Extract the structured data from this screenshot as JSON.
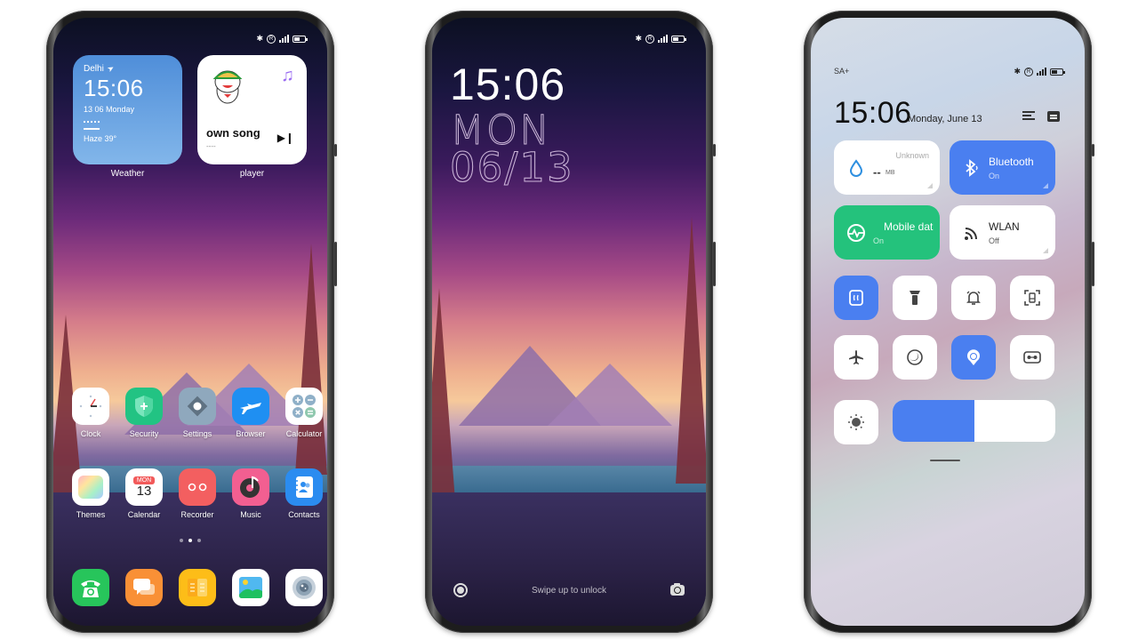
{
  "phones": {
    "home": {
      "status_icons": [
        "bluetooth-icon",
        "registered-icon",
        "signal-icon",
        "battery-icon"
      ],
      "weather_widget": {
        "city": "Delhi",
        "time": "15:06",
        "date": "13 06 Monday",
        "condition": "Haze 39°",
        "label": "Weather",
        "bg_color": "#5a9ae0"
      },
      "player_widget": {
        "song": "own song",
        "artist": "----",
        "label": "player",
        "note_glyph": "♫",
        "next_glyph": "▶❙"
      },
      "apps_row1": [
        {
          "label": "Clock",
          "icon": "clock-icon",
          "color": "#ffffff"
        },
        {
          "label": "Security",
          "icon": "shield-icon",
          "color": "#22c383"
        },
        {
          "label": "Settings",
          "icon": "settings-icon",
          "color": "#8fa8bd"
        },
        {
          "label": "Browser",
          "icon": "plane-icon",
          "color": "#1f8ff2"
        },
        {
          "label": "Calculator",
          "icon": "calculator-icon",
          "color": "#ffffff"
        }
      ],
      "apps_row2": [
        {
          "label": "Themes",
          "icon": "themes-icon",
          "color": "#ffffff"
        },
        {
          "label": "Calendar",
          "icon": "calendar-icon",
          "color": "#ffffff",
          "day": "MON",
          "date": "13"
        },
        {
          "label": "Recorder",
          "icon": "recorder-icon",
          "color": "#f35f60"
        },
        {
          "label": "Music",
          "icon": "music-icon",
          "color": "#f25f91"
        },
        {
          "label": "Contacts",
          "icon": "contacts-icon",
          "color": "#2b8cf0"
        }
      ],
      "page_dots": {
        "count": 3,
        "active": 2
      },
      "dock": [
        {
          "name": "phone",
          "icon": "phone-icon",
          "color": "#27c55b"
        },
        {
          "name": "messages",
          "icon": "messages-icon",
          "color": "#f99036"
        },
        {
          "name": "notes",
          "icon": "notes-icon",
          "color": "#fdbd18"
        },
        {
          "name": "gallery",
          "icon": "gallery-icon",
          "color": "#ffffff"
        },
        {
          "name": "camera",
          "icon": "camera-lens-icon",
          "color": "#ffffff"
        }
      ]
    },
    "lock": {
      "time": "15:06",
      "day": "MON",
      "date": "06/13",
      "swipe_hint": "Swipe up to unlock"
    },
    "control_center": {
      "carrier": "SA+",
      "time": "15:06",
      "date": "Monday, June 13",
      "big_tiles": [
        {
          "title": "Unknown",
          "value": "--",
          "unit": "MB",
          "icon": "water-drop-icon",
          "state": "data-usage"
        },
        {
          "title": "Bluetooth",
          "sub": "On",
          "icon": "bluetooth-icon",
          "state": "active"
        },
        {
          "title": "Mobile data",
          "sub": "On",
          "icon": "mobile-data-icon",
          "state": "active"
        },
        {
          "title": "WLAN",
          "sub": "Off",
          "icon": "wifi-icon",
          "state": "inactive"
        }
      ],
      "small_tiles": [
        {
          "name": "vibrate",
          "icon": "vibrate-icon",
          "active": true
        },
        {
          "name": "flashlight",
          "icon": "flashlight-icon",
          "active": false
        },
        {
          "name": "notifications",
          "icon": "bell-icon",
          "active": false
        },
        {
          "name": "screenshot",
          "icon": "screenshot-icon",
          "active": false
        },
        {
          "name": "airplane-mode",
          "icon": "airplane-icon",
          "active": false
        },
        {
          "name": "dark-mode",
          "icon": "moon-icon",
          "active": false
        },
        {
          "name": "location",
          "icon": "location-icon",
          "active": true
        },
        {
          "name": "reading-mode",
          "icon": "vr-icon",
          "active": false
        }
      ],
      "brightness_percent": 50,
      "accent": "#4a7ff0"
    }
  }
}
